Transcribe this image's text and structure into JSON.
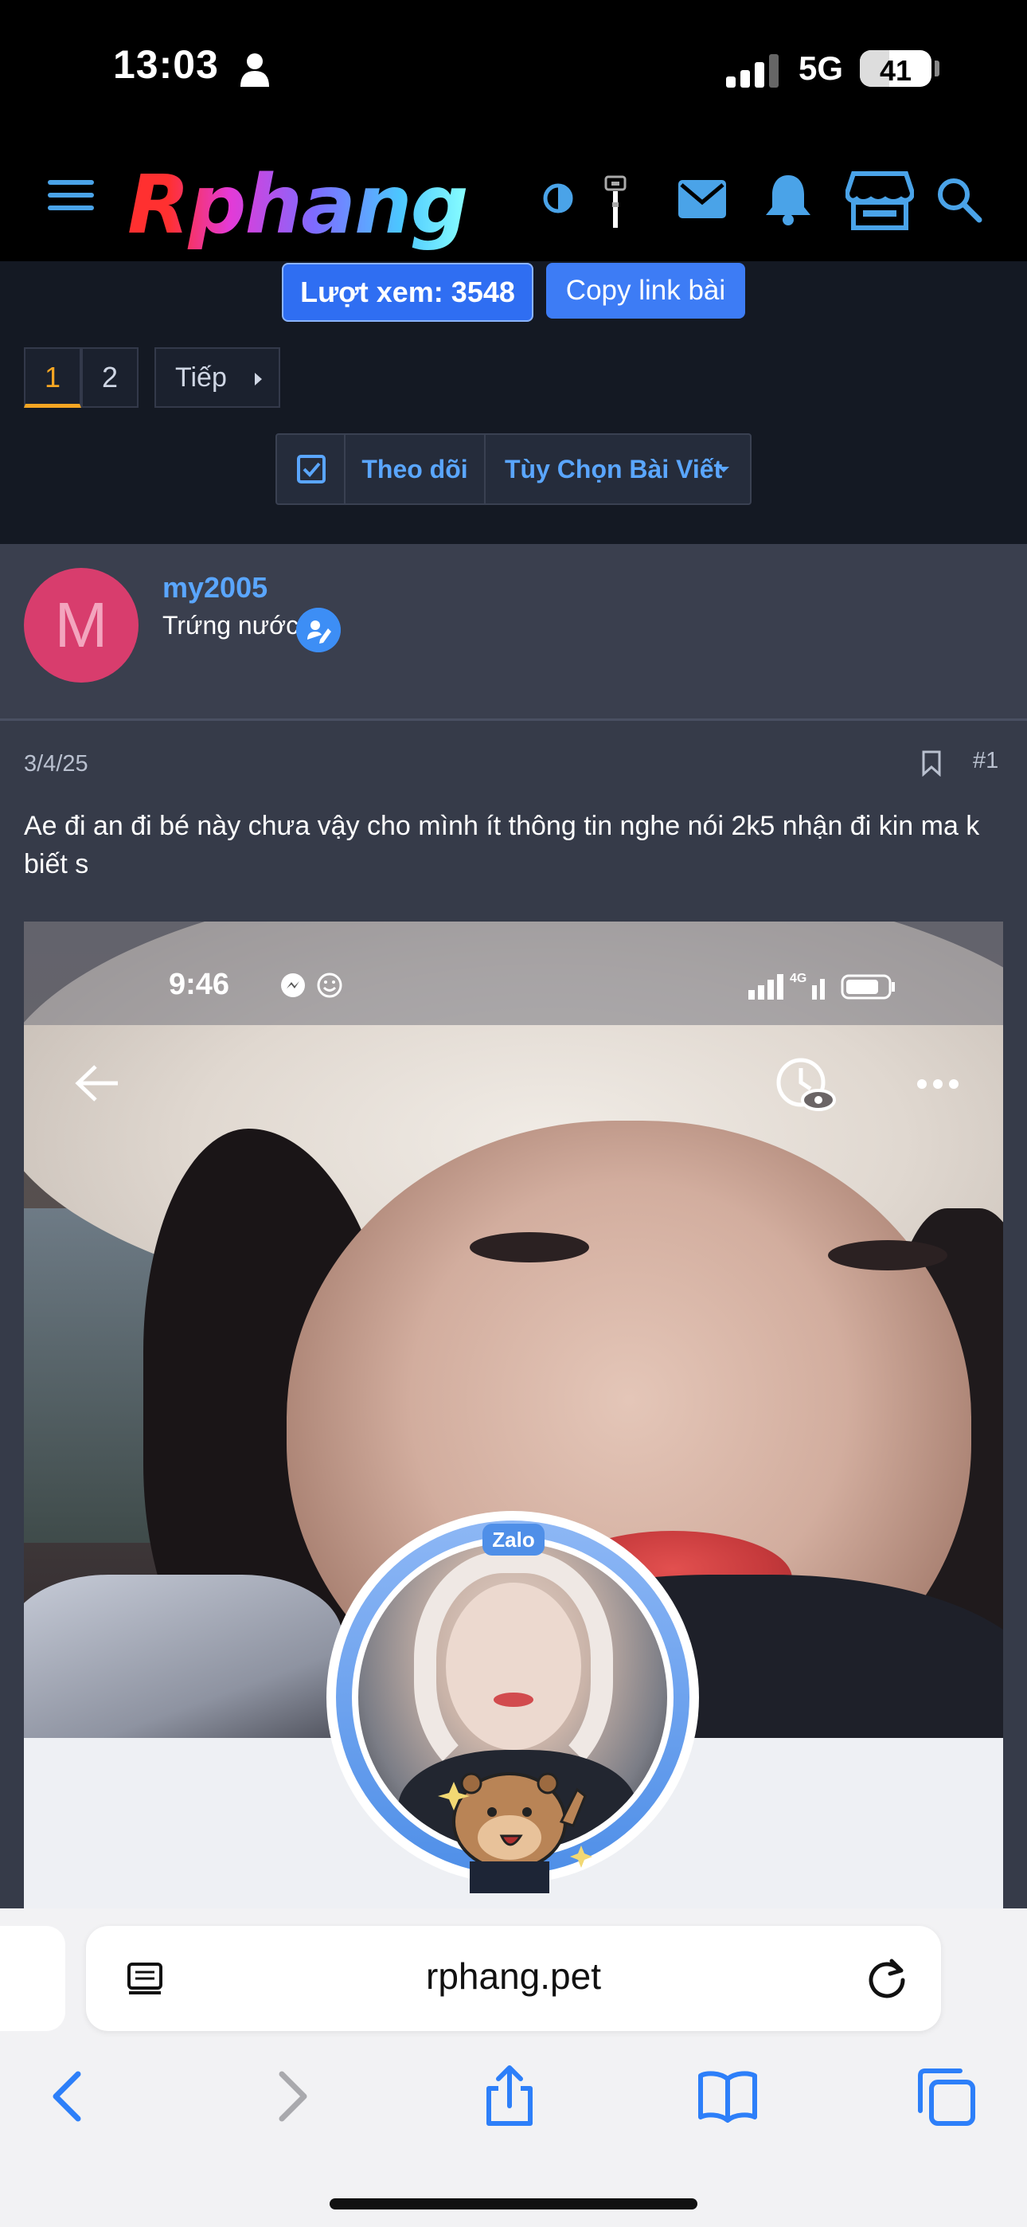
{
  "status_bar": {
    "time": "13:03",
    "network": "5G",
    "battery": "41",
    "battery_level": 0.41
  },
  "header": {
    "logo": "Rphang",
    "icons": [
      "menu-icon",
      "theme-toggle-icon",
      "flashlight-icon",
      "mail-icon",
      "bell-icon",
      "store-icon",
      "search-icon"
    ]
  },
  "thread_bar": {
    "views_label": "Lượt xem: 3548",
    "copy_link_label": "Copy link bài"
  },
  "pagination": {
    "pages": [
      "1",
      "2"
    ],
    "current": "1",
    "next_label": "Tiếp"
  },
  "thread_actions": {
    "follow_label": "Theo dõi",
    "options_label": "Tùy Chọn Bài Viết"
  },
  "post": {
    "author": {
      "initial": "M",
      "name": "my2005",
      "title": "Trứng nước"
    },
    "date": "3/4/25",
    "number": "#1",
    "text": "Ae đi an đi bé này chưa vậy cho mình ít thông tin nghe nói 2k5 nhận đi kin ma k biết s",
    "image": {
      "status_time": "9:46",
      "network_label": "4G",
      "zalo_label": "Zalo"
    }
  },
  "browser": {
    "url": "rphang.pet",
    "toolbar_icons": [
      "back-icon",
      "forward-icon",
      "share-icon",
      "bookmarks-icon",
      "tabs-icon"
    ]
  }
}
